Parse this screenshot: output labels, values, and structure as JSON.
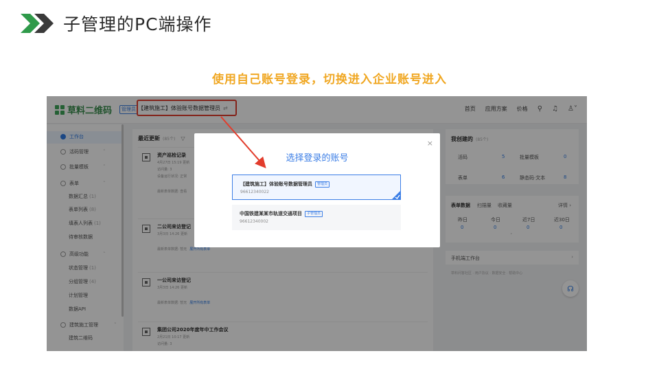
{
  "slide": {
    "title": "子管理的PC端操作",
    "subtitle": "使用自己账号登录，切换进入企业账号进入"
  },
  "app": {
    "brand": "草料二维码",
    "admin_tag": "管理员",
    "current_account": "【建筑施工】体验账号数据管理员",
    "switch_icon": "swap-icon",
    "nav": [
      "首页",
      "应用方案",
      "价格"
    ],
    "highlight_color": "#e23c2c",
    "accent_color": "#3b7ee6"
  },
  "sidebar": {
    "items": [
      {
        "label": "工作台",
        "count": "",
        "active": true
      },
      {
        "label": "活码管理",
        "count": "",
        "active": false
      },
      {
        "label": "批量模板",
        "count": "",
        "active": false
      },
      {
        "label": "表单",
        "count": "",
        "active": false
      },
      {
        "label": "数据汇总",
        "count": "(1)",
        "active": false
      },
      {
        "label": "表单列表",
        "count": "(8)",
        "active": false
      },
      {
        "label": "填表人列表",
        "count": "(1)",
        "active": false
      },
      {
        "label": "待审核数据",
        "count": "",
        "active": false
      },
      {
        "label": "高级功能",
        "count": "",
        "active": false
      },
      {
        "label": "状态管理",
        "count": "(1)",
        "active": false
      },
      {
        "label": "分组管理",
        "count": "(4)",
        "active": false
      },
      {
        "label": "计划管理",
        "count": "",
        "active": false
      },
      {
        "label": "数据API",
        "count": "",
        "active": false
      },
      {
        "label": "建筑施工管理",
        "count": "",
        "active": false
      },
      {
        "label": "建筑二维码",
        "count": "",
        "active": false
      }
    ]
  },
  "main": {
    "title": "最近更新",
    "count": "(85个)",
    "records": [
      {
        "title": "资产巡检记录",
        "line1": "4月27日 15:19 更新",
        "line2": "访问量: 3",
        "line3": "设备运行状况: 正常",
        "line4": "最新表单数据: 查看",
        "link": ""
      },
      {
        "title": "二公司来访登记",
        "line1": "3月3日 14:26 更新",
        "line2": "",
        "line3": "",
        "line4": "最新表单数据: 暂无",
        "link": "展开所有表单"
      },
      {
        "title": "一公司来访登记",
        "line1": "3月3日 14:26 更新",
        "line2": "",
        "line3": "",
        "line4": "最新表单数据: 暂无",
        "link": "展开所有表单"
      },
      {
        "title": "集团公司2020年度年中工作会议",
        "line1": "2月21日 10:17 更新",
        "line2": "访问量: 3",
        "line3": "",
        "line4": "",
        "link": ""
      }
    ]
  },
  "right": {
    "title": "我创建的",
    "count": "(85个)",
    "stats": [
      {
        "label": "活码",
        "value": "5"
      },
      {
        "label": "批量模板",
        "value": "0"
      },
      {
        "label": "表单",
        "value": "6"
      },
      {
        "label": "静态码·文本",
        "value": "8"
      }
    ],
    "tabs": [
      "表单数据",
      "扫描量",
      "收藏量"
    ],
    "detail_label": "详情",
    "periods": [
      {
        "label": "昨日",
        "value": "0"
      },
      {
        "label": "今日",
        "value": "0"
      },
      {
        "label": "近7日",
        "value": "0"
      },
      {
        "label": "近30日",
        "value": "0"
      }
    ],
    "mobile_title": "手机端工作台",
    "footer_text": "草料问答社区 · 用户协议 · 数据安全 · 帮助中心"
  },
  "modal": {
    "title": "选择登录的账号",
    "accounts": [
      {
        "name": "【建筑施工】体验账号数据管理员",
        "role": "管理员",
        "id": "96612340022",
        "selected": true
      },
      {
        "name": "中国铁建某某市轨道交通项目",
        "role": "子管理员",
        "id": "96612340002",
        "selected": false
      }
    ]
  }
}
